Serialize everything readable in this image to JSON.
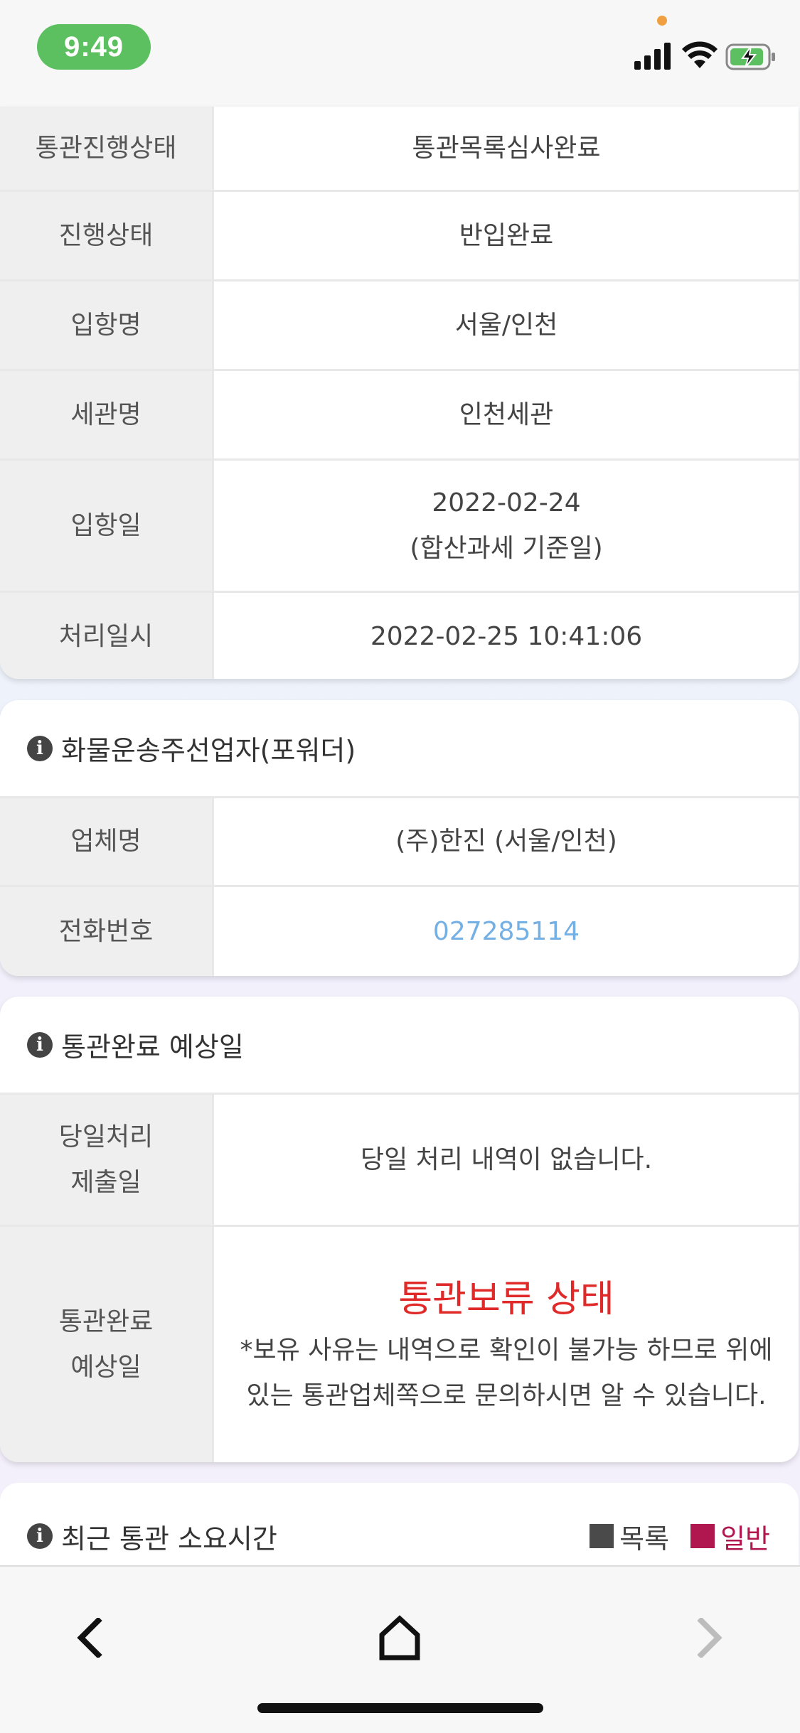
{
  "status_bar": {
    "time": "9:49"
  },
  "clearance_section": {
    "rows": [
      {
        "label": "통관진행상태",
        "value": "통관목록심사완료"
      },
      {
        "label": "진행상태",
        "value": "반입완료"
      },
      {
        "label": "입항명",
        "value": "서울/인천"
      },
      {
        "label": "세관명",
        "value": "인천세관"
      },
      {
        "label": "입항일",
        "value": "2022-02-24",
        "value_note": "(합산과세 기준일)"
      },
      {
        "label": "처리일시",
        "value": "2022-02-25 10:41:06"
      }
    ]
  },
  "forwarder_section": {
    "title": "화물운송주선업자(포워더)",
    "rows": [
      {
        "label": "업체명",
        "value": "(주)한진 (서울/인천)"
      },
      {
        "label": "전화번호",
        "value": "027285114"
      }
    ]
  },
  "expected_section": {
    "title": "통관완료 예상일",
    "rows": [
      {
        "label_line1": "당일처리",
        "label_line2": "제출일",
        "value": "당일 처리 내역이 없습니다."
      },
      {
        "label_line1": "통관완료",
        "label_line2": "예상일",
        "status": "통관보류 상태",
        "note": "*보유 사유는 내역으로 확인이 불가능 하므로 위에 있는 통관업체쪽으로 문의하시면 알 수 있습니다."
      }
    ]
  },
  "recent_section": {
    "title": "최근 통관 소요시간",
    "legend": [
      {
        "label": "목록",
        "color": "#4a4a4a"
      },
      {
        "label": "일반",
        "color": "#b0174f"
      }
    ]
  },
  "colors": {
    "status_red": "#e02a2a",
    "phone_link": "#74b0e4",
    "time_pill": "#5cc060"
  }
}
